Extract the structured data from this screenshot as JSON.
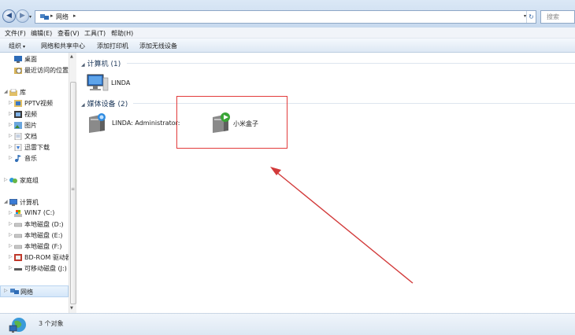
{
  "address_bar": {
    "breadcrumb": "网络",
    "search_placeholder": "搜索"
  },
  "menu": [
    "文件(F)",
    "编辑(E)",
    "查看(V)",
    "工具(T)",
    "帮助(H)"
  ],
  "command_bar": {
    "organize": "组织",
    "items": [
      "网络和共享中心",
      "添加打印机",
      "添加无线设备"
    ]
  },
  "nav_pane": {
    "favorites": [
      "桌面",
      "最近访问的位置"
    ],
    "library": {
      "label": "库",
      "items": [
        "PPTV视频",
        "视频",
        "图片",
        "文档",
        "迅雷下载",
        "音乐"
      ]
    },
    "homegroup": "家庭组",
    "computer": {
      "label": "计算机",
      "items": [
        "WIN7 (C:)",
        "本地磁盘 (D:)",
        "本地磁盘 (E:)",
        "本地磁盘 (F:)",
        "BD-ROM 驱动器",
        "可移动磁盘 (J:)"
      ]
    },
    "network": "网络"
  },
  "content": {
    "groups": [
      {
        "title": "计算机 (1)",
        "items": [
          "LINDA"
        ]
      },
      {
        "title": "媒体设备 (2)",
        "items": [
          "LINDA: Administrator:",
          "小米盒子"
        ]
      }
    ]
  },
  "status": {
    "count_text": "3 个对象"
  },
  "colors": {
    "highlight": "#e23b3b",
    "arrow": "#d23a3a",
    "group_header": "#1e395b"
  }
}
